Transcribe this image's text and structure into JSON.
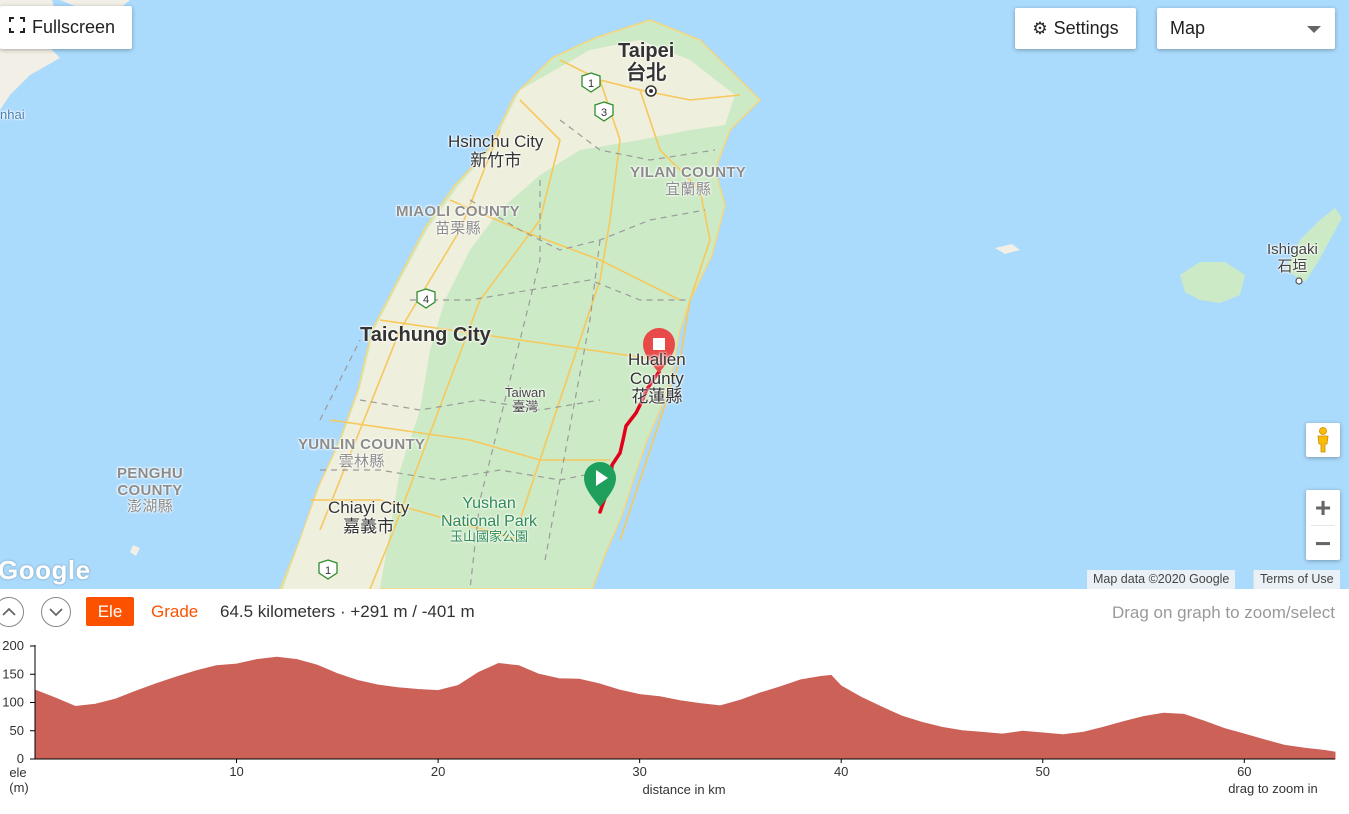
{
  "map": {
    "fullscreen_label": "Fullscreen",
    "settings_label": "Settings",
    "map_type": "Map",
    "attribution": "Map data ©2020 Google",
    "terms": "Terms of Use",
    "logo": "Google",
    "zoom_in": "+",
    "zoom_out": "−",
    "icons": {
      "fullscreen": "fullscreen-icon",
      "settings": "gear-icon",
      "dropdown": "caret-down-icon",
      "pegman": "street-view-pegman-icon",
      "start": "start-marker-play-icon",
      "end": "end-marker-stop-icon"
    },
    "labels": {
      "taipei_en": "Taipei",
      "taipei_zh": "台北",
      "hsinchu_en": "Hsinchu City",
      "hsinchu_zh": "新竹市",
      "yilan_en": "YILAN COUNTY",
      "yilan_zh": "宜蘭縣",
      "miaoli_en": "MIAOLI COUNTY",
      "miaoli_zh": "苗栗縣",
      "taichung": "Taichung City",
      "taiwan_en": "Taiwan",
      "taiwan_zh": "臺灣",
      "hualien_en1": "Hualien",
      "hualien_en2": "County",
      "hualien_zh": "花蓮縣",
      "yunlin_en": "YUNLIN COUNTY",
      "yunlin_zh": "雲林縣",
      "penghu_en1": "PENGHU",
      "penghu_en2": "COUNTY",
      "penghu_zh": "澎湖縣",
      "chiayi_en": "Chiayi City",
      "chiayi_zh": "嘉義市",
      "yushan_en1": "Yushan",
      "yushan_en2": "National Park",
      "yushan_zh": "玉山國家公園",
      "ishigaki_en": "Ishigaki",
      "ishigaki_zh": "石垣",
      "nhai": "nhai",
      "hw1": "1",
      "hw3": "3",
      "hw4": "4",
      "hw1b": "1"
    }
  },
  "profile": {
    "ele_tab": "Ele",
    "grade_tab": "Grade",
    "summary": "64.5 kilometers · +291 m / -401 m",
    "drag_hint": "Drag on graph to zoom/select",
    "icons": {
      "collapse": "chevron-up-icon",
      "expand": "chevron-down-icon"
    }
  },
  "chart_data": {
    "type": "area",
    "title": "",
    "xlabel": "distance in km",
    "ylabel": "ele (m)",
    "ylabel_line1": "ele",
    "ylabel_line2": "(m)",
    "footer_hint": "drag to zoom in",
    "xlim": [
      0,
      64.5
    ],
    "ylim": [
      0,
      200
    ],
    "xticks": [
      10,
      20,
      30,
      40,
      50,
      60
    ],
    "yticks": [
      0,
      50,
      100,
      150,
      200
    ],
    "fill_color": "#cc6158",
    "grid": false,
    "x": [
      0,
      1,
      2,
      3,
      4,
      5,
      6,
      7,
      8,
      9,
      10,
      11,
      12,
      13,
      14,
      15,
      16,
      17,
      18,
      19,
      20,
      21,
      22,
      23,
      24,
      25,
      26,
      27,
      28,
      29,
      30,
      31,
      32,
      33,
      34,
      35,
      36,
      37,
      38,
      39,
      39.5,
      40,
      41,
      42,
      43,
      44,
      45,
      46,
      47,
      48,
      49,
      50,
      51,
      52,
      53,
      54,
      55,
      56,
      57,
      58,
      59,
      60,
      61,
      62,
      63,
      64,
      64.5
    ],
    "y": [
      122,
      108,
      93,
      97,
      106,
      120,
      133,
      145,
      156,
      165,
      168,
      176,
      180,
      176,
      166,
      151,
      139,
      131,
      126,
      123,
      121,
      130,
      153,
      169,
      165,
      150,
      142,
      141,
      133,
      122,
      114,
      110,
      103,
      98,
      94,
      104,
      117,
      128,
      140,
      146,
      148,
      129,
      109,
      92,
      76,
      65,
      56,
      50,
      47,
      44,
      49,
      46,
      43,
      47,
      56,
      66,
      75,
      81,
      79,
      67,
      54,
      44,
      34,
      24,
      19,
      15,
      12
    ]
  }
}
